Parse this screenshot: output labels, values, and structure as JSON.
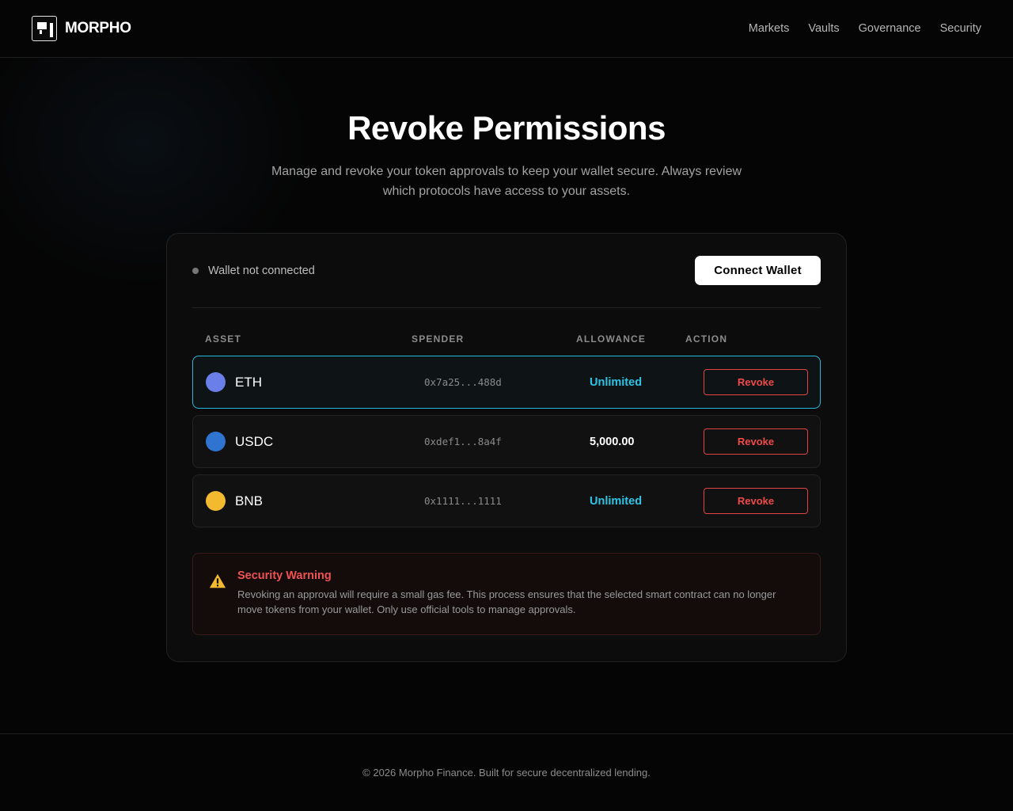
{
  "header": {
    "brand": "MORPHO",
    "nav": [
      "Markets",
      "Vaults",
      "Governance",
      "Security"
    ]
  },
  "hero": {
    "title": "Revoke Permissions",
    "subtitle": "Manage and revoke your token approvals to keep your wallet secure. Always review which protocols have access to your assets."
  },
  "wallet": {
    "status": "Wallet not connected",
    "connect_label": "Connect Wallet"
  },
  "table": {
    "headers": [
      "ASSET",
      "SPENDER",
      "ALLOWANCE",
      "ACTION"
    ],
    "rows": [
      {
        "symbol": "ETH",
        "spender": "0x7a25...488d",
        "allowance": "Unlimited",
        "action": "Revoke",
        "icon_color": "#6b7fe8"
      },
      {
        "symbol": "USDC",
        "spender": "0xdef1...8a4f",
        "allowance": "5,000.00",
        "action": "Revoke",
        "icon_color": "#2f74d0"
      },
      {
        "symbol": "BNB",
        "spender": "0x1111...1111",
        "allowance": "Unlimited",
        "action": "Revoke",
        "icon_color": "#f3ba2f"
      }
    ]
  },
  "warning": {
    "title": "Security Warning",
    "text": "Revoking an approval will require a small gas fee. This process ensures that the selected smart contract can no longer move tokens from your wallet. Only use official tools to manage approvals."
  },
  "footer": {
    "text": "© 2026 Morpho Finance. Built for secure decentralized lending."
  },
  "colors": {
    "accent": "#22b8d6",
    "danger": "#ef4a4a",
    "warning_icon": "#f3ba2f"
  }
}
